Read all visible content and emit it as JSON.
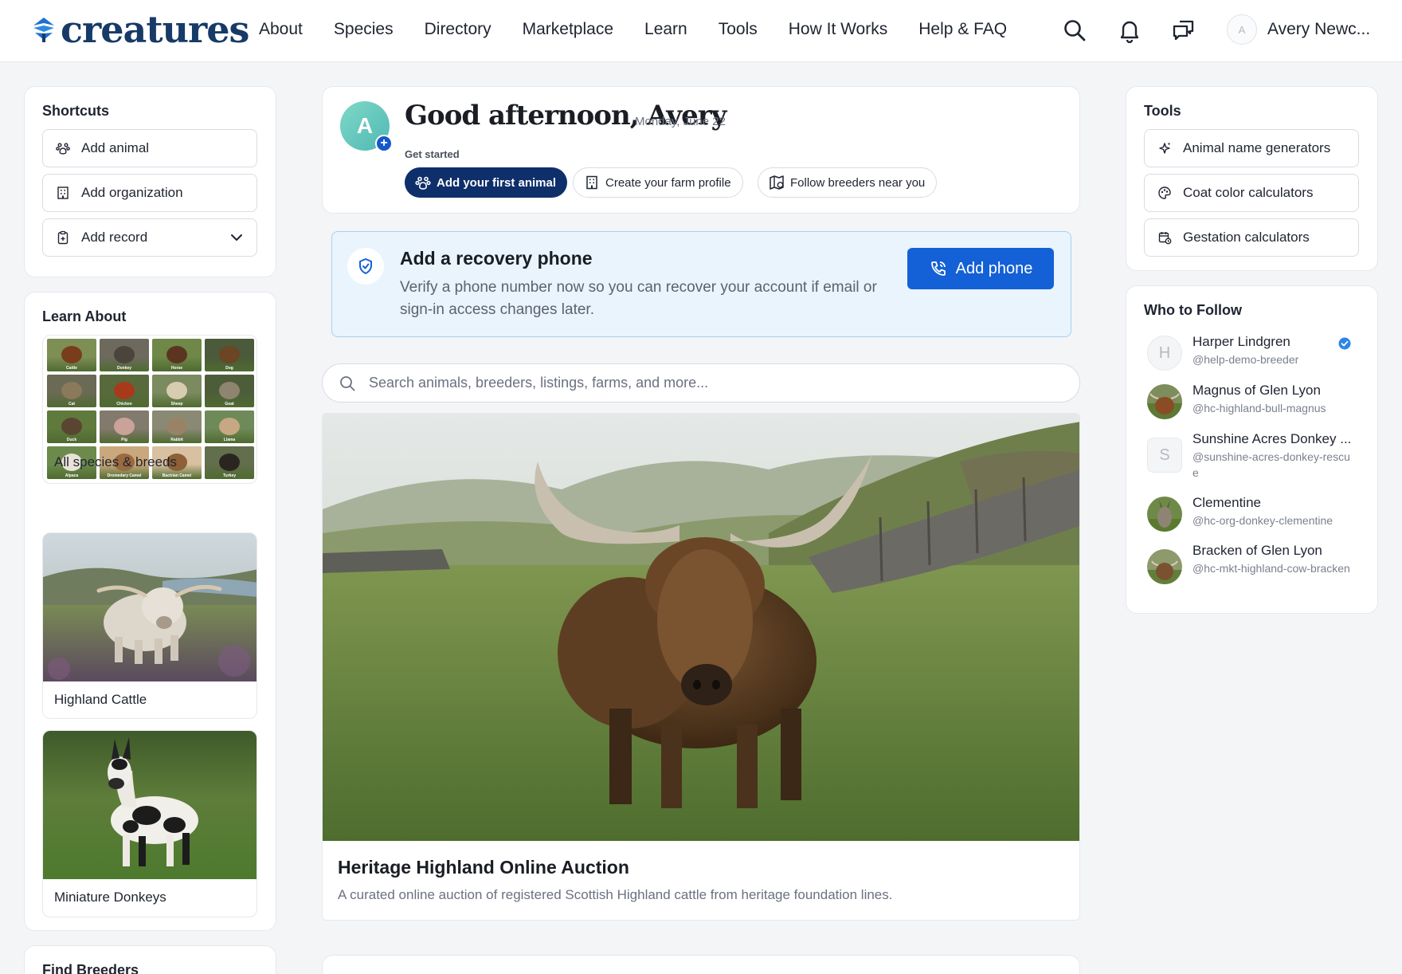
{
  "brand": {
    "name": "creatures"
  },
  "nav": {
    "links": [
      "About",
      "Species",
      "Directory",
      "Marketplace",
      "Learn",
      "Tools",
      "How It Works",
      "Help & FAQ"
    ],
    "icons": [
      "search-icon",
      "bell-icon",
      "messages-icon"
    ],
    "user": {
      "initial": "A",
      "name": "Avery Newc..."
    }
  },
  "shortcuts": {
    "title": "Shortcuts",
    "items": [
      {
        "label": "Add animal",
        "icon": "paw-icon"
      },
      {
        "label": "Add organization",
        "icon": "building-icon"
      },
      {
        "label": "Add record",
        "icon": "clipboard-icon"
      }
    ]
  },
  "learn": {
    "title": "Learn About",
    "species": [
      "Cattle",
      "Donkey",
      "Horse",
      "Dog",
      "Cat",
      "Chicken",
      "Sheep",
      "Goat",
      "Duck",
      "Pig",
      "Rabbit",
      "Llama",
      "Alpaca",
      "Dromedary Camel",
      "Bactrian Camel",
      "Turkey"
    ],
    "all_label": "All species & breeds",
    "tiles": [
      "Highland Cattle",
      "Miniature Donkeys"
    ]
  },
  "find_breeders": {
    "title": "Find Breeders"
  },
  "greeting": {
    "avatar_initial": "A",
    "title": "Good afternoon, Avery",
    "date": "Monday, June 22",
    "get_started": "Get started",
    "pills": [
      "Add your first animal",
      "Create your farm profile",
      "Follow breeders near you"
    ]
  },
  "recovery": {
    "title": "Add a recovery phone",
    "text": "Verify a phone number now so you can recover your account if email or sign-in access changes later.",
    "button": "Add phone"
  },
  "search": {
    "placeholder": "Search animals, breeders, listings, farms, and more..."
  },
  "feed": {
    "title": "Heritage Highland Online Auction",
    "subtitle": "A curated online auction of registered Scottish Highland cattle from heritage foundation lines."
  },
  "tools": {
    "title": "Tools",
    "items": [
      {
        "label": "Animal name generators",
        "icon": "sparkle-icon"
      },
      {
        "label": "Coat color calculators",
        "icon": "palette-icon"
      },
      {
        "label": "Gestation calculators",
        "icon": "calendar-icon"
      }
    ]
  },
  "who_to_follow": {
    "title": "Who to Follow",
    "people": [
      {
        "name": "Harper Lindgren",
        "handle": "@help-demo-breeder",
        "initial": "H",
        "verified": true
      },
      {
        "name": "Magnus of Glen Lyon",
        "handle": "@hc-highland-bull-magnus"
      },
      {
        "name": "Sunshine Acres Donkey ...",
        "handle": "@sunshine-acres-donkey-rescue",
        "initial": "S"
      },
      {
        "name": "Clementine",
        "handle": "@hc-org-donkey-clementine"
      },
      {
        "name": "Bracken of Glen Lyon",
        "handle": "@hc-mkt-highland-cow-bracken"
      }
    ]
  },
  "colors": {
    "brand": "#173a67",
    "primary_button": "#1460d6",
    "pill_primary": "#0f2f6b",
    "alert_bg": "#e9f4fd"
  }
}
